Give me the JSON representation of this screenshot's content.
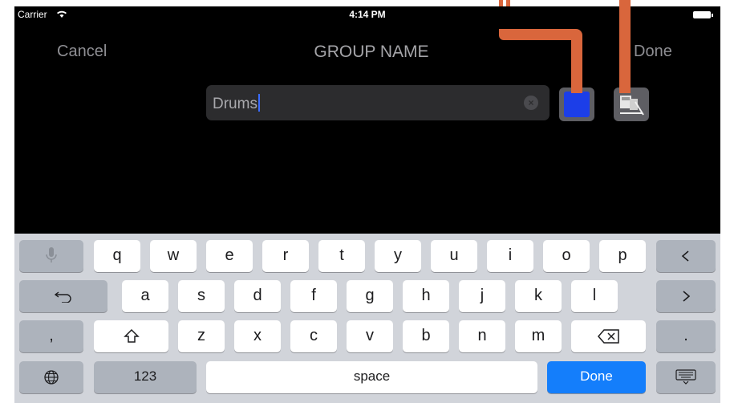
{
  "status_bar": {
    "carrier": "Carrier",
    "time": "4:14 PM"
  },
  "nav": {
    "cancel_label": "Cancel",
    "title": "GROUP NAME",
    "done_label": "Done"
  },
  "name_field": {
    "value": "Drums"
  },
  "color_button": {
    "swatch_color": "#1c3ee8"
  },
  "keyboard": {
    "row1": [
      "q",
      "w",
      "e",
      "r",
      "t",
      "y",
      "u",
      "i",
      "o",
      "p"
    ],
    "row2": [
      "a",
      "s",
      "d",
      "f",
      "g",
      "h",
      "j",
      "k",
      "l"
    ],
    "row3": [
      "z",
      "x",
      "c",
      "v",
      "b",
      "n",
      "m"
    ],
    "comma": ",",
    "period": ".",
    "numbers_label": "123",
    "space_label": "space",
    "done_label": "Done",
    "icons": [
      "microphone-icon",
      "backspace-left-icon",
      "undo-icon",
      "chevron-right-icon",
      "shift-icon",
      "delete-icon",
      "globe-icon",
      "keyboard-hide-icon"
    ]
  },
  "callout_color": "#d9663c"
}
